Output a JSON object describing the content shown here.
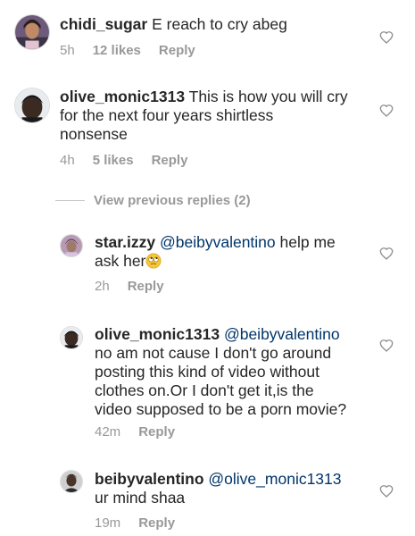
{
  "comments": [
    {
      "username": "chidi_sugar",
      "text": " E reach to cry abeg",
      "time": "5h",
      "likes": "12 likes",
      "reply": "Reply"
    },
    {
      "username": "olive_monic1313",
      "text_line1": " This is how you will cry",
      "text_line2": "for the next four years shirtless",
      "text_line3": "nonsense",
      "time": "4h",
      "likes": "5 likes",
      "reply": "Reply"
    }
  ],
  "view_previous": "View previous replies (2)",
  "replies": [
    {
      "username": "star.izzy",
      "mention": "@beibyvalentino",
      "text_line1": " help me",
      "text_line2": "ask her",
      "emoji": "face-with-rolling-eyes",
      "time": "2h",
      "reply": "Reply"
    },
    {
      "username": "olive_monic1313",
      "mention": "@beibyvalentino",
      "text_line2": "no am not cause I don't go around",
      "text_line3": "posting this kind of video without",
      "text_line4": "clothes on.Or I don't get it,is the",
      "text_line5": "video supposed to be a porn movie?",
      "time": "42m",
      "reply": "Reply"
    },
    {
      "username": "beibyvalentino",
      "mention": "@olive_monic1313",
      "text_line2": "ur mind shaa",
      "time": "19m",
      "reply": "Reply"
    }
  ],
  "icons": {
    "like": "heart-outline-icon"
  },
  "colors": {
    "text": "#262626",
    "meta": "#999999",
    "mention": "#003569"
  }
}
